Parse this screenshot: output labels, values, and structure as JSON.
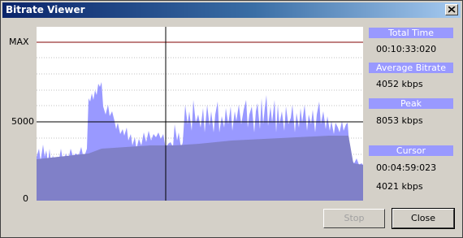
{
  "window": {
    "title": "Bitrate Viewer"
  },
  "graph": {
    "y_labels": {
      "max": "MAX",
      "mid": "5000",
      "zero": "0"
    }
  },
  "info": {
    "total_time_label": "Total Time",
    "total_time_value": "00:10:33:020",
    "average_label": "Average Bitrate",
    "average_value": "4052 kbps",
    "peak_label": "Peak",
    "peak_value": "8053 kbps",
    "cursor_label": "Cursor",
    "cursor_time": "00:04:59:023",
    "cursor_bitrate": "4021 kbps"
  },
  "buttons": {
    "stop": "Stop",
    "close": "Close"
  },
  "colors": {
    "titlebar_start": "#0a246a",
    "graph_fill": "#9999ff",
    "average_fill": "#8888cc",
    "max_line": "#800000"
  }
}
